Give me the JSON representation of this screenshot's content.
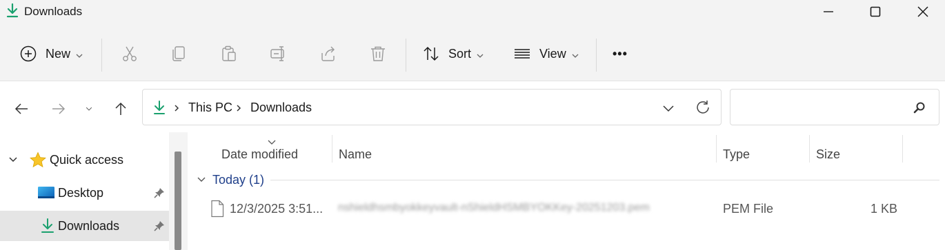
{
  "window": {
    "title": "Downloads",
    "accent": "#1aa06e"
  },
  "toolbar": {
    "new_label": "New",
    "sort_label": "Sort",
    "view_label": "View",
    "more_label": "•••"
  },
  "address": {
    "crumbs": [
      "This PC",
      "Downloads"
    ]
  },
  "search": {
    "placeholder": ""
  },
  "sidebar": {
    "items": [
      {
        "label": "Quick access",
        "icon": "star-icon"
      },
      {
        "label": "Desktop",
        "icon": "desktop-icon"
      },
      {
        "label": "Downloads",
        "icon": "download-icon",
        "selected": true
      }
    ]
  },
  "columns": [
    "Date modified",
    "Name",
    "Type",
    "Size"
  ],
  "group": {
    "label": "Today (1)"
  },
  "files": [
    {
      "date": "12/3/2025 3:51...",
      "name": "nshieldhsmbyokkeyvault-nShieldHSMBYOKKey-20251203.pem",
      "type": "PEM File",
      "size": "1 KB"
    }
  ]
}
